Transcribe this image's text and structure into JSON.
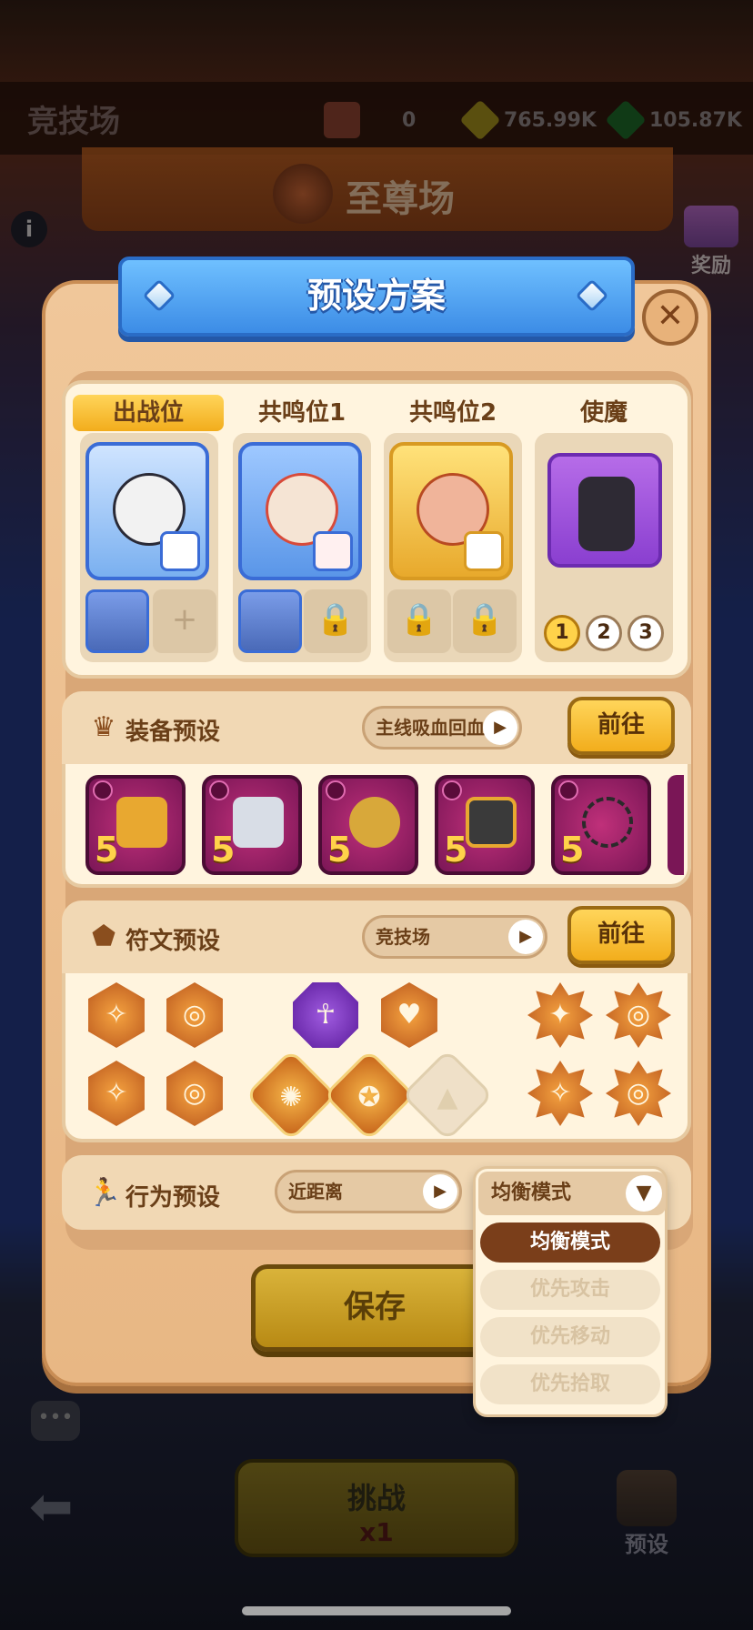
{
  "background": {
    "screen_title": "竞技场",
    "resources": [
      {
        "icon": "ticket-icon",
        "value": "0"
      },
      {
        "icon": "gold-gem-icon",
        "value": "765.99K"
      },
      {
        "icon": "green-gem-icon",
        "value": "105.87K"
      }
    ],
    "arena_name": "至尊场",
    "reward_label": "奖励",
    "challenge_label": "挑战",
    "challenge_cost": "x1",
    "preset_label": "预设"
  },
  "dialog": {
    "title": "预设方案",
    "hero_section": {
      "slots": [
        {
          "label": "出战位"
        },
        {
          "label": "共鸣位1"
        },
        {
          "label": "共鸣位2"
        },
        {
          "label": "使魔"
        }
      ],
      "pet_levels": [
        "1",
        "2",
        "3"
      ],
      "active_level": "1"
    },
    "equipment": {
      "title": "装备预设",
      "selected": "主线吸血回血流",
      "go_label": "前往",
      "items": [
        {
          "stars": "5",
          "icon": "helmet-icon"
        },
        {
          "stars": "5",
          "icon": "armor-icon"
        },
        {
          "stars": "5",
          "icon": "ring-icon"
        },
        {
          "stars": "5",
          "icon": "knight-helmet-icon"
        },
        {
          "stars": "5",
          "icon": "necklace-icon"
        }
      ]
    },
    "runes": {
      "title": "符文预设",
      "selected": "竞技场",
      "go_label": "前往"
    },
    "behavior": {
      "title": "行为预设",
      "range": "近距离",
      "mode": "均衡模式",
      "options": [
        "均衡模式",
        "优先攻击",
        "优先移动",
        "优先拾取"
      ]
    },
    "save_label": "保存"
  },
  "colors": {
    "accent_blue": "#3c8ce6",
    "gold_button": "#f2ad1c",
    "dialog_bg": "#f0c79a",
    "dropdown_active": "#7a3e1a"
  }
}
